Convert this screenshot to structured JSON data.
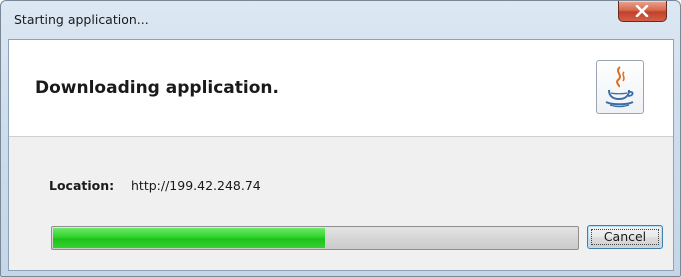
{
  "window": {
    "title": "Starting application..."
  },
  "header": {
    "title": "Downloading application.",
    "icon": "java-coffee-cup-icon"
  },
  "location": {
    "label": "Location:",
    "value": "http://199.42.248.74"
  },
  "progress": {
    "fraction": 0.52
  },
  "buttons": {
    "cancel_label": "Cancel",
    "close_icon": "close-icon"
  },
  "colors": {
    "progress_fill": "#2fd42a",
    "close_button": "#c2412a"
  }
}
